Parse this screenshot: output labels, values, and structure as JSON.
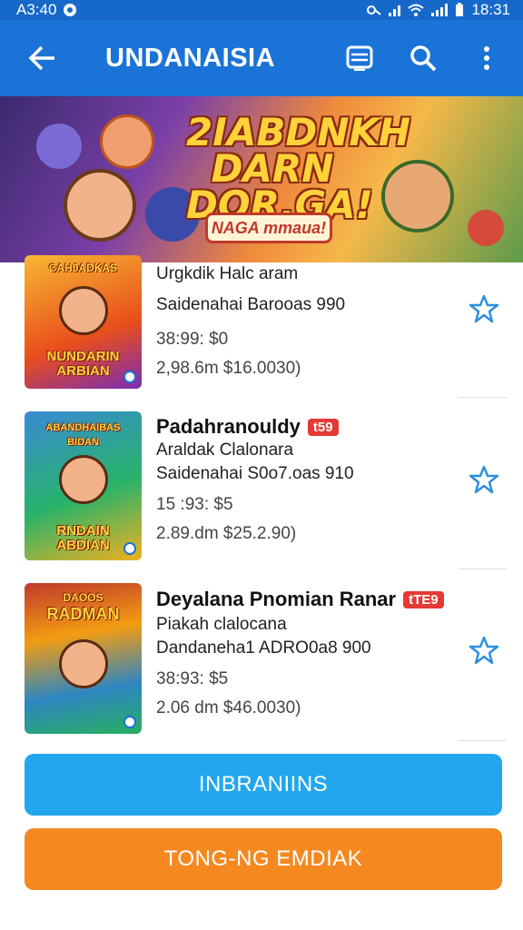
{
  "status_bar": {
    "time": "A3:40",
    "clock": "18:31"
  },
  "app_bar": {
    "title": "UNDANAISIA",
    "back_icon": "back-arrow-icon",
    "actions": [
      "list-icon",
      "search-icon",
      "more-vert-icon"
    ]
  },
  "banner": {
    "title": "2IABDNKH DARN DOR.GA!",
    "subtitle": "NAGA mmaua!"
  },
  "items": [
    {
      "thumb_title": "NUNDARIN ARBIAN",
      "top_label": "CAHJADKAS",
      "name": "",
      "badge": "",
      "line1": "Urgkdik Halc aram",
      "line2": "Saidenahai Barooas 990",
      "line3": "38:99: $0",
      "line4": "2,98.6m   $16.0030)"
    },
    {
      "thumb_title": "RNDAIN ABDIAN",
      "top_label": "ABANDHAIBAS BIDAN",
      "name": "Padahranouldy",
      "badge": "t59",
      "line1": "Araldak Clalonara",
      "line2": "Saidenahai S0o7.oas 910",
      "line3": "15 :93: $5",
      "line4": "2.89.dm   $25.2.90)"
    },
    {
      "thumb_title": "RADMAN",
      "top_label": "DAOOS",
      "name": "Deyalana Pnomian Ranar",
      "badge": "tTE9",
      "line1": "Piakah clalocana",
      "line2": "Dandaneha1 ADRO0a8 900",
      "line3": "38:93: $5",
      "line4": "2.06 dm   $46.0030)"
    }
  ],
  "buttons": {
    "primary": "INBRANIINS",
    "secondary": "TONG-NG EMDIAK"
  },
  "colors": {
    "app_bar": "#1a73d6",
    "primary_button": "#22a7ee",
    "secondary_button": "#f5891f",
    "badge": "#e53935",
    "star": "#2b8fe0"
  }
}
